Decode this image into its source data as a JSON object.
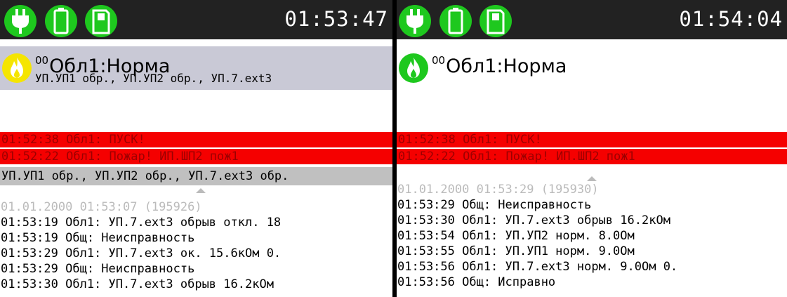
{
  "colors": {
    "indicator": "#1ec81e",
    "alarm_row": "#f50000",
    "alarm_text": "#9c0000",
    "fault_row": "#c0c0c0",
    "status_selected": "#c9c9d6",
    "topbar": "#222222"
  },
  "left": {
    "clock": "01:53:47",
    "indicators": [
      "power-icon",
      "battery-icon",
      "sim-card-icon"
    ],
    "zone_prefix": "00",
    "zone_title": "Обл1:Норма",
    "zone_sub": "УП.УП1 обр., УП.УП2 обр., УП.7.ext3",
    "events": [
      "01:52:38 Обл1: ПУСК!",
      "01:52:22 Обл1: Пожар! ИП.ШП2 пож1"
    ],
    "fault_line": "УП.УП1 обр., УП.УП2 обр., УП.7.ext3 обр.",
    "log_header": "01.01.2000 01:53:07 (195926)",
    "log": [
      "01:53:19 Обл1: УП.7.ext3 обрыв откл. 18",
      "01:53:19 Общ: Неисправность",
      "01:53:29 Обл1: УП.7.ext3 ок. 15.6кОм 0.",
      "01:53:29 Общ: Неисправность",
      "01:53:30 Обл1: УП.7.ext3 обрыв 16.2кОм"
    ]
  },
  "right": {
    "clock": "01:54:04",
    "indicators": [
      "power-icon",
      "battery-icon",
      "sim-card-icon"
    ],
    "zone_prefix": "00",
    "zone_title": "Обл1:Норма",
    "events": [
      "01:52:38 Обл1: ПУСК!",
      "01:52:22 Обл1: Пожар! ИП.ШП2 пож1"
    ],
    "log_header": "01.01.2000 01:53:29 (195930)",
    "log": [
      "01:53:29 Общ: Неисправность",
      "01:53:30 Обл1: УП.7.ext3 обрыв 16.2кОм",
      "01:53:54 Обл1: УП.УП2 норм. 8.0Ом",
      "01:53:55 Обл1: УП.УП1 норм. 9.0Ом",
      "01:53:56 Обл1: УП.7.ext3 норм. 9.0Ом 0.",
      "01:53:56 Общ: Исправно"
    ]
  }
}
